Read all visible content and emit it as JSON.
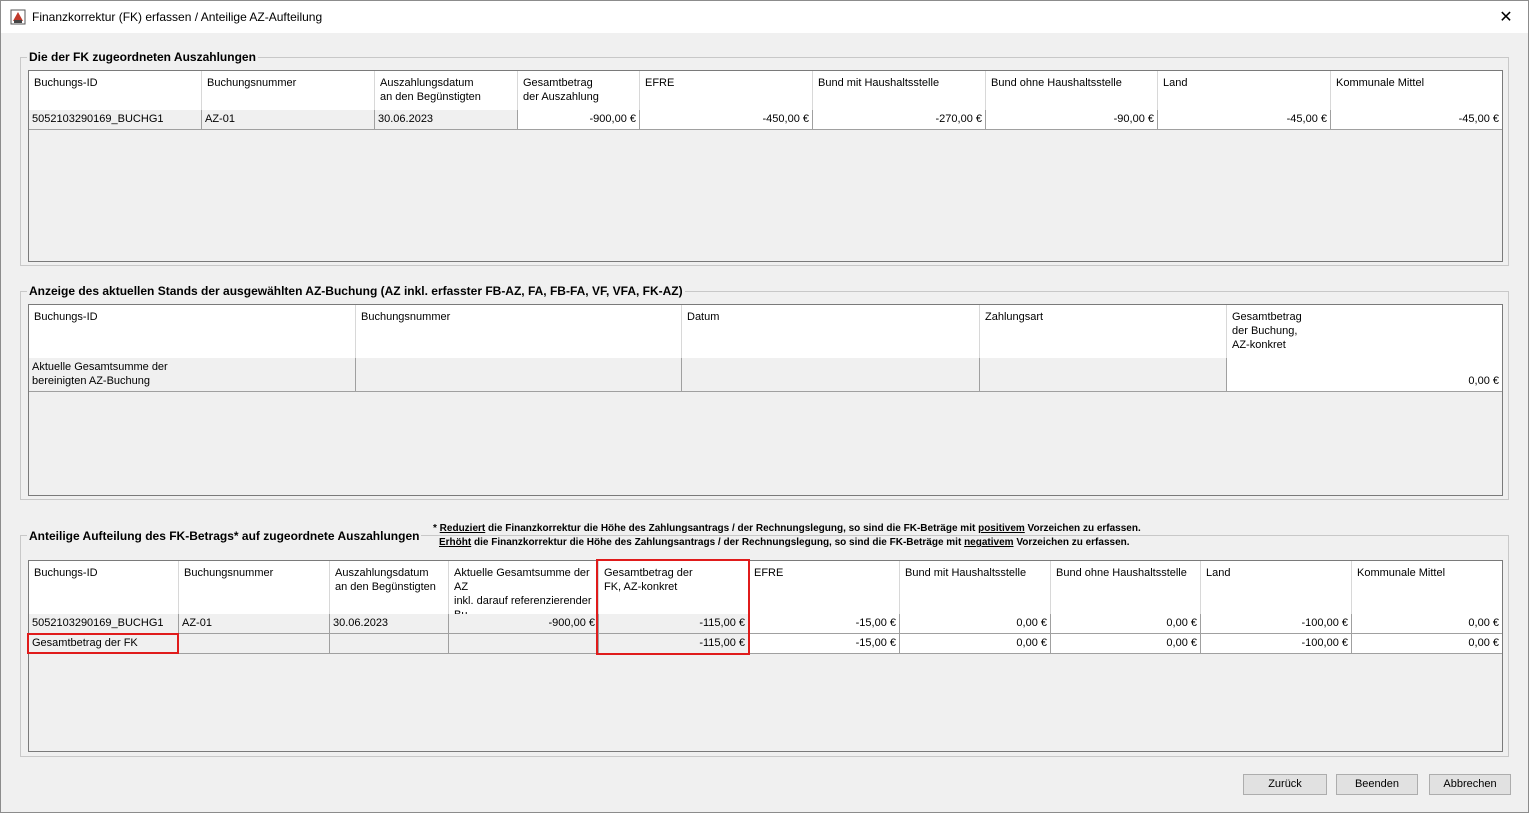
{
  "window": {
    "title": "Finanzkorrektur (FK) erfassen / Anteilige AZ-Aufteilung",
    "close_glyph": "✕"
  },
  "section1": {
    "legend": "Die der FK zugeordneten Auszahlungen",
    "headers": [
      "Buchungs-ID",
      "Buchungsnummer",
      "Auszahlungsdatum\nan den Begünstigten",
      "Gesamtbetrag\nder Auszahlung",
      "EFRE",
      "Bund mit Haushaltsstelle",
      "Bund ohne Haushaltsstelle",
      "Land",
      "Kommunale Mittel"
    ],
    "rows": [
      [
        "5052103290169_BUCHG1",
        "AZ-01",
        "30.06.2023",
        "-900,00 €",
        "-450,00 €",
        "-270,00 €",
        "-90,00 €",
        "-45,00 €",
        "-45,00 €"
      ]
    ]
  },
  "section2": {
    "legend": "Anzeige des aktuellen Stands der ausgewählten AZ-Buchung (AZ inkl. erfasster FB-AZ, FA, FB-FA, VF, VFA, FK-AZ)",
    "headers": [
      "Buchungs-ID",
      "Buchungsnummer",
      "Datum",
      "Zahlungsart",
      "Gesamtbetrag\nder Buchung,\nAZ-konkret"
    ],
    "rows": [
      [
        "Aktuelle Gesamtsumme der\nbereinigten AZ-Buchung",
        "",
        "",
        "",
        "0,00 €"
      ]
    ]
  },
  "section3": {
    "legend": "Anteilige Aufteilung des FK-Betrags* auf zugeordnete Auszahlungen",
    "note_line1": {
      "star": "* ",
      "em": "Reduziert",
      "text1": " die Finanzkorrektur die Höhe des Zahlungsantrags / der Rechnungslegung, so sind die FK-Beträge mit ",
      "em2": "positivem",
      "text2": " Vorzeichen zu erfassen."
    },
    "note_line2": {
      "em": "Erhöht",
      "text1": " die Finanzkorrektur die Höhe des Zahlungsantrags / der Rechnungslegung, so sind die FK-Beträge mit ",
      "em2": "negativem",
      "text2": " Vorzeichen zu erfassen."
    },
    "headers": [
      "Buchungs-ID",
      "Buchungsnummer",
      "Auszahlungsdatum\nan den Begünstigten",
      "Aktuelle Gesamtsumme der\nAZ\ninkl. darauf referenzierender\nBu",
      "Gesamtbetrag der\nFK, AZ-konkret",
      "EFRE",
      "Bund mit Haushaltsstelle",
      "Bund ohne Haushaltsstelle",
      "Land",
      "Kommunale Mittel"
    ],
    "rows": [
      [
        "5052103290169_BUCHG1",
        "AZ-01",
        "30.06.2023",
        "-900,00 €",
        "-115,00 €",
        "-15,00 €",
        "0,00 €",
        "0,00 €",
        "-100,00 €",
        "0,00 €"
      ],
      [
        "Gesamtbetrag der FK",
        "",
        "",
        "",
        "-115,00 €",
        "-15,00 €",
        "0,00 €",
        "0,00 €",
        "-100,00 €",
        "0,00 €"
      ]
    ]
  },
  "buttons": {
    "back": "Zurück",
    "finish": "Beenden",
    "cancel": "Abbrechen"
  },
  "colors": {
    "highlight": "#e01b1b"
  }
}
